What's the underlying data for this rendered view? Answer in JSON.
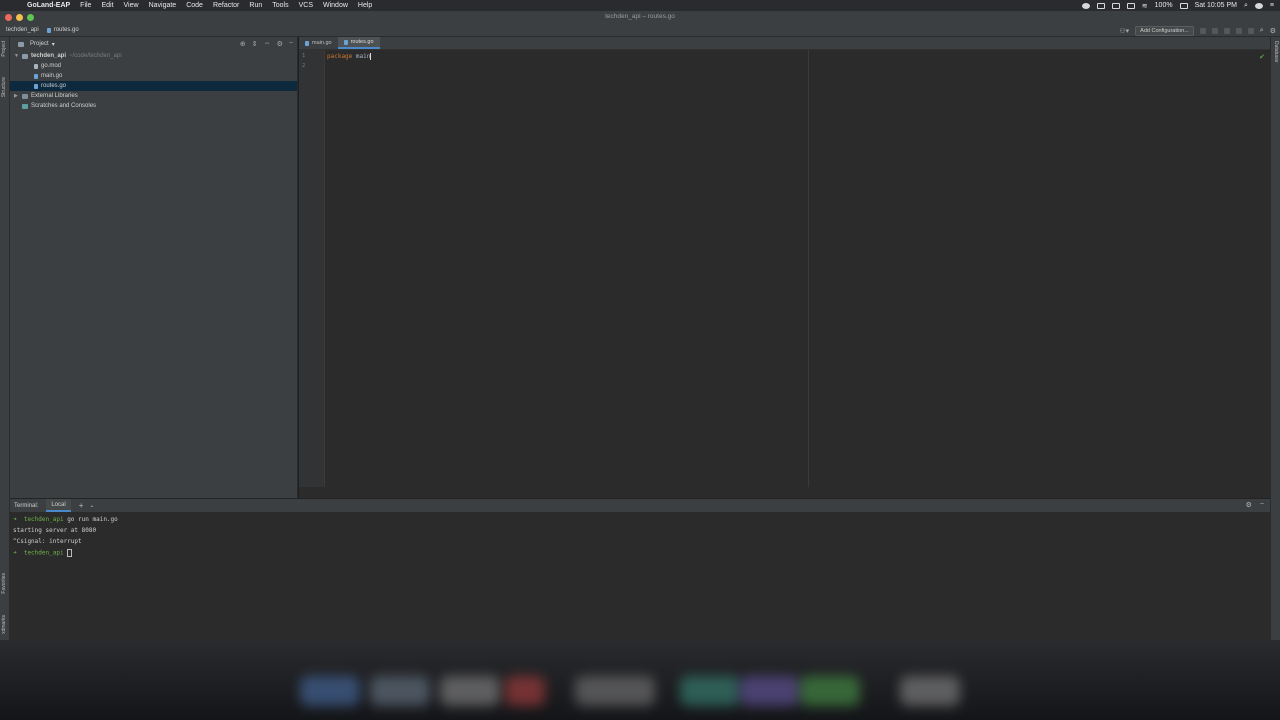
{
  "menubar": {
    "app_name": "GoLand-EAP",
    "items": [
      "File",
      "Edit",
      "View",
      "Navigate",
      "Code",
      "Refactor",
      "Run",
      "Tools",
      "VCS",
      "Window",
      "Help"
    ],
    "battery": "100%",
    "clock": "Sat 10:05 PM"
  },
  "window": {
    "title": "techden_api – routes.go"
  },
  "navbar": {
    "project_crumb": "techden_api",
    "file_crumb": "routes.go",
    "add_configuration": "Add Configuration..."
  },
  "stripes": {
    "project": "Project",
    "structure": "Structure",
    "favorites": "Favorites",
    "bookmarks": "xdmarks",
    "database": "Database"
  },
  "project_panel": {
    "header": "Project",
    "root": "techden_api",
    "root_path": "~/code/techden_api",
    "files": [
      "go.mod",
      "main.go",
      "routes.go"
    ],
    "external": "External Libraries",
    "scratches": "Scratches and Consoles"
  },
  "editor": {
    "tabs": [
      "main.go",
      "routes.go"
    ],
    "active_tab": "routes.go",
    "line_numbers": [
      "1",
      "2"
    ],
    "code_keyword": "package",
    "code_name": "main"
  },
  "terminal": {
    "label": "Terminal:",
    "tab": "Local",
    "lines": [
      {
        "prompt": "➜  techden_api",
        "text": " go run main.go"
      },
      {
        "prompt": "",
        "text": "starting server at 8080"
      },
      {
        "prompt": "",
        "text": "^Csignal: interrupt"
      },
      {
        "prompt": "➜  techden_api",
        "text": " "
      }
    ]
  },
  "colors": {
    "accent": "#4a88c7",
    "keyword": "#cc7832",
    "prompt": "#6fb04a",
    "selection": "#0d293e"
  }
}
